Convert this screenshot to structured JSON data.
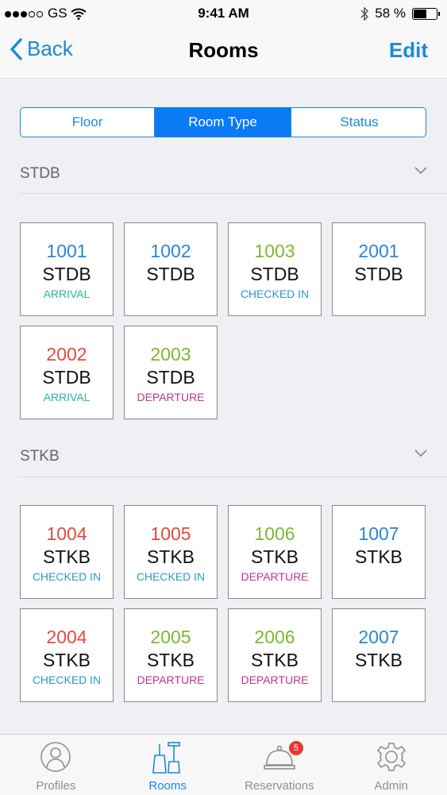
{
  "status_bar": {
    "carrier": "GS",
    "time": "9:41 AM",
    "battery": "58 %",
    "battery_level": 0.58
  },
  "nav": {
    "back_label": "Back",
    "title": "Rooms",
    "edit_label": "Edit"
  },
  "segments": [
    {
      "label": "Floor",
      "active": false
    },
    {
      "label": "Room Type",
      "active": true
    },
    {
      "label": "Status",
      "active": false
    }
  ],
  "colors": {
    "accent": "#1a8ad8",
    "blue": "#2a86d6",
    "green": "#7cb82f",
    "red": "#e04b3f",
    "teal": "#26b5a4",
    "checked_in": "#2a9bc8",
    "departure": "#b8378f"
  },
  "sections": [
    {
      "title": "STDB",
      "rooms": [
        {
          "number": "1001",
          "type": "STDB",
          "status": "ARRIVAL",
          "number_color": "blue",
          "status_color": "teal"
        },
        {
          "number": "1002",
          "type": "STDB",
          "status": "",
          "number_color": "blue",
          "status_color": "teal"
        },
        {
          "number": "1003",
          "type": "STDB",
          "status": "CHECKED IN",
          "number_color": "green",
          "status_color": "checked_in"
        },
        {
          "number": "2001",
          "type": "STDB",
          "status": "",
          "number_color": "blue",
          "status_color": "teal"
        },
        {
          "number": "2002",
          "type": "STDB",
          "status": "ARRIVAL",
          "number_color": "red",
          "status_color": "teal"
        },
        {
          "number": "2003",
          "type": "STDB",
          "status": "DEPARTURE",
          "number_color": "green",
          "status_color": "departure"
        }
      ]
    },
    {
      "title": "STKB",
      "rooms": [
        {
          "number": "1004",
          "type": "STKB",
          "status": "CHECKED IN",
          "number_color": "red",
          "status_color": "checked_in"
        },
        {
          "number": "1005",
          "type": "STKB",
          "status": "CHECKED IN",
          "number_color": "red",
          "status_color": "checked_in"
        },
        {
          "number": "1006",
          "type": "STKB",
          "status": "DEPARTURE",
          "number_color": "green",
          "status_color": "departure"
        },
        {
          "number": "1007",
          "type": "STKB",
          "status": "",
          "number_color": "blue",
          "status_color": "teal"
        },
        {
          "number": "2004",
          "type": "STKB",
          "status": "CHECKED IN",
          "number_color": "red",
          "status_color": "checked_in"
        },
        {
          "number": "2005",
          "type": "STKB",
          "status": "DEPARTURE",
          "number_color": "green",
          "status_color": "departure"
        },
        {
          "number": "2006",
          "type": "STKB",
          "status": "DEPARTURE",
          "number_color": "green",
          "status_color": "departure"
        },
        {
          "number": "2007",
          "type": "STKB",
          "status": "",
          "number_color": "blue",
          "status_color": "teal"
        }
      ]
    }
  ],
  "tabs": [
    {
      "label": "Profiles",
      "icon": "person-icon",
      "active": false
    },
    {
      "label": "Rooms",
      "icon": "cleaning-icon",
      "active": true
    },
    {
      "label": "Reservations",
      "icon": "bell-icon",
      "active": false,
      "badge": "5"
    },
    {
      "label": "Admin",
      "icon": "gear-icon",
      "active": false
    }
  ]
}
